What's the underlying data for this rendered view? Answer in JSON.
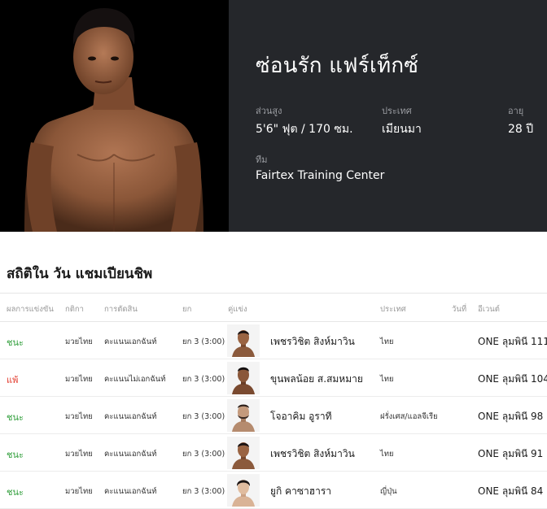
{
  "fighter": {
    "name": "ซ่อนรัก แฟร์เท็กซ์",
    "height_label": "ส่วนสูง",
    "height_value": "5'6\" ฟุต / 170 ซม.",
    "country_label": "ประเทศ",
    "country_value": "เมียนมา",
    "age_label": "อายุ",
    "age_value": "28 ปี",
    "team_label": "ทีม",
    "team_value": "Fairtex Training Center"
  },
  "stats": {
    "title": "สถิติใน วัน แชมเปียนชิพ",
    "headers": {
      "result": "ผลการแข่งขัน",
      "sport": "กติกา",
      "method": "การตัดสิน",
      "round": "ยก",
      "opponent": "คู่แข่ง",
      "country": "ประเทศ",
      "date": "วันที่",
      "event": "อีเวนต์"
    },
    "rows": [
      {
        "result": "ชนะ",
        "outcome": "win",
        "sport": "มวยไทย",
        "method": "คะแนนเอกฉันท์",
        "round": "ยก 3 (3:00)",
        "opponent": "เพชรวิชิต สิงห์มาวิน",
        "country": "ไทย",
        "event": "ONE ลุมพินี 111"
      },
      {
        "result": "แพ้",
        "outcome": "loss",
        "sport": "มวยไทย",
        "method": "คะแนนไม่เอกฉันท์",
        "round": "ยก 3 (3:00)",
        "opponent": "ขุนพลน้อย ส.สมหมาย",
        "country": "ไทย",
        "event": "ONE ลุมพินี 104"
      },
      {
        "result": "ชนะ",
        "outcome": "win",
        "sport": "มวยไทย",
        "method": "คะแนนเอกฉันท์",
        "round": "ยก 3 (3:00)",
        "opponent": "โจอาคิม อูราที",
        "country": "ฝรั่งเศส/แอลจีเรีย",
        "event": "ONE ลุมพินี 98"
      },
      {
        "result": "ชนะ",
        "outcome": "win",
        "sport": "มวยไทย",
        "method": "คะแนนเอกฉันท์",
        "round": "ยก 3 (3:00)",
        "opponent": "เพชรวิชิต สิงห์มาวิน",
        "country": "ไทย",
        "event": "ONE ลุมพินี 91"
      },
      {
        "result": "ชนะ",
        "outcome": "win",
        "sport": "มวยไทย",
        "method": "คะแนนเอกฉันท์",
        "round": "ยก 3 (3:00)",
        "opponent": "ยูกิ คาซาฮารา",
        "country": "ญี่ปุ่น",
        "event": "ONE ลุมพินี 84"
      }
    ]
  },
  "colors": {
    "win": "#2f9e3a",
    "loss": "#e23a2c",
    "hero_bg": "#25272b"
  },
  "icons": {
    "fighter_photo": "fighter-portrait",
    "opponent_photo": "opponent-avatar"
  }
}
